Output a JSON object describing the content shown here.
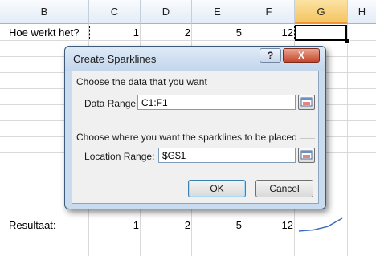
{
  "sheet": {
    "columns": [
      "B",
      "C",
      "D",
      "E",
      "F",
      "G",
      "H"
    ],
    "row1": {
      "label": "Hoe werkt het?",
      "values": [
        "1",
        "2",
        "5",
        "12"
      ]
    },
    "row2": {
      "label": "Resultaat:",
      "values": [
        "1",
        "2",
        "5",
        "12"
      ]
    },
    "sparkline_values": [
      1,
      2,
      5,
      12
    ],
    "colors": {
      "selected_header": "#f4c462",
      "sparkline": "#3f6ebf"
    }
  },
  "dialog": {
    "title": "Create Sparklines",
    "help_label": "?",
    "close_label": "X",
    "data_section_label": "Choose the data that you want",
    "data_range_label_ul": "D",
    "data_range_label_rest": "ata Range:",
    "data_range_value": "C1:F1",
    "location_section_label": "Choose where you want the sparklines to be placed",
    "location_range_label_ul": "L",
    "location_range_label_rest": "ocation Range:",
    "location_range_value": "$G$1",
    "ok_label": "OK",
    "cancel_label": "Cancel"
  }
}
